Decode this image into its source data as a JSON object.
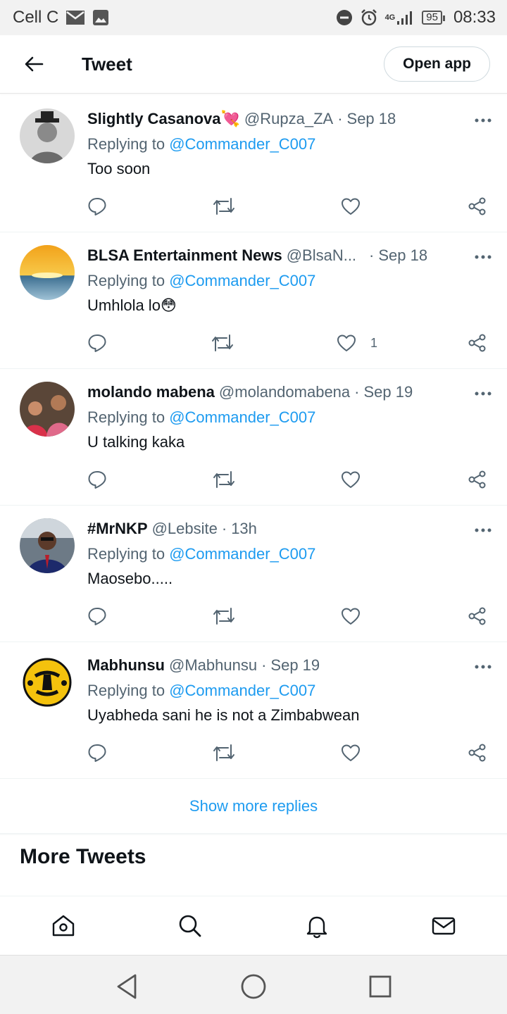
{
  "status_bar": {
    "carrier": "Cell C",
    "network": "4G",
    "battery": "95",
    "time": "08:33",
    "icons": [
      "mail-icon",
      "image-icon",
      "dnd-icon",
      "alarm-icon",
      "signal-icon",
      "battery-icon"
    ]
  },
  "header": {
    "title": "Tweet",
    "open_app_label": "Open app"
  },
  "tweets": [
    {
      "display_name": "Slightly Casanova💘",
      "handle": "@Rupza_ZA",
      "dot": "·",
      "date": "Sep 18",
      "replying_prefix": "Replying to ",
      "replying_to": "@Commander_C007",
      "text": "Too soon",
      "likes": ""
    },
    {
      "display_name": "BLSA Entertainment News",
      "handle": "@BlsaN...",
      "dot": "·",
      "date": "Sep 18",
      "replying_prefix": "Replying to ",
      "replying_to": "@Commander_C007",
      "text": "Umhlola lo😳",
      "likes": "1"
    },
    {
      "display_name": "molando mabena",
      "handle": "@molandomabena",
      "dot": "·",
      "date": "Sep 19",
      "replying_prefix": "Replying to ",
      "replying_to": "@Commander_C007",
      "text": "U talking kaka",
      "likes": ""
    },
    {
      "display_name": "#MrNKP",
      "handle": "@Lebsite",
      "dot": "·",
      "date": "13h",
      "replying_prefix": "Replying to ",
      "replying_to": "@Commander_C007",
      "text": "Maosebo.....",
      "likes": ""
    },
    {
      "display_name": "Mabhunsu",
      "handle": "@Mabhunsu",
      "dot": "·",
      "date": "Sep 19",
      "replying_prefix": "Replying to ",
      "replying_to": "@Commander_C007",
      "text": "Uyabheda sani he is not a Zimbabwean",
      "likes": ""
    }
  ],
  "show_more_replies": "Show more replies",
  "more_tweets_heading": "More Tweets",
  "tab_bar": [
    "home-icon",
    "search-icon",
    "notifications-icon",
    "messages-icon"
  ],
  "system_nav": [
    "back-triangle-icon",
    "home-circle-icon",
    "recents-square-icon"
  ],
  "colors": {
    "accent": "#1d9bf0",
    "text_primary": "#0f1419",
    "text_secondary": "#536471",
    "divider": "#eff3f4"
  }
}
